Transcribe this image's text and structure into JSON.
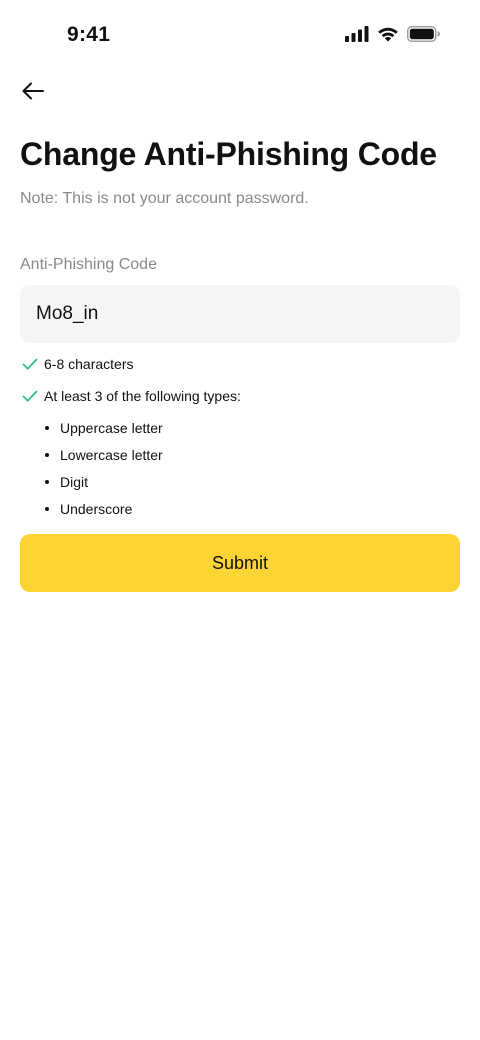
{
  "status_bar": {
    "time": "9:41",
    "icons": [
      "cellular-signal-icon",
      "wifi-icon",
      "battery-icon"
    ]
  },
  "nav": {
    "back_icon": "arrow-left-icon"
  },
  "header": {
    "title": "Change Anti-Phishing Code",
    "note": "Note: This is not your account password."
  },
  "form": {
    "label": "Anti-Phishing Code",
    "value": "Mo8_in"
  },
  "requirements": {
    "length": "6-8 characters",
    "types_intro": "At least 3 of the following types:",
    "types": [
      "Uppercase letter",
      "Lowercase letter",
      "Digit",
      "Underscore"
    ],
    "check_icon": "check-icon"
  },
  "actions": {
    "submit_label": "Submit"
  },
  "colors": {
    "accent": "#fcd535",
    "check": "#2ebd85",
    "muted_text": "#8a8a8a",
    "input_bg": "#f5f5f5"
  }
}
